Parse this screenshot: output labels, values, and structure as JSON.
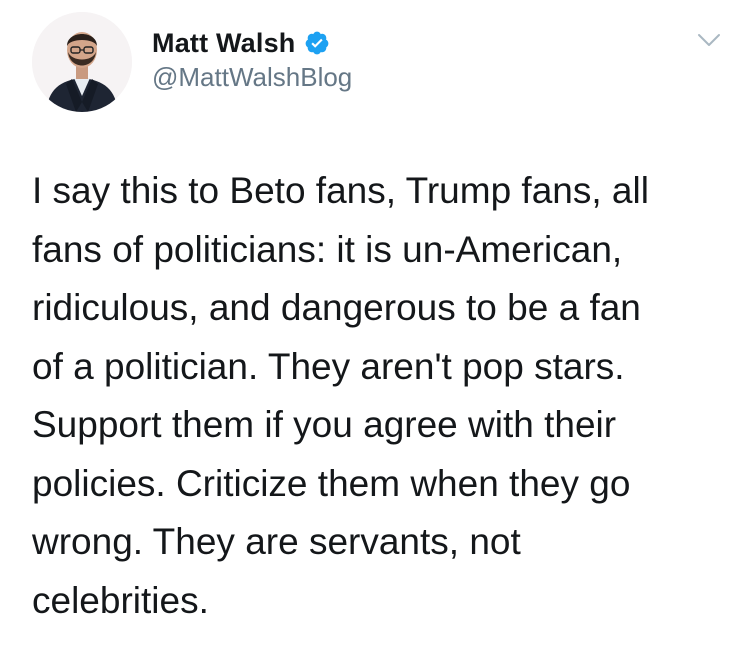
{
  "tweet": {
    "author": {
      "display_name": "Matt Walsh",
      "handle": "@MattWalshBlog",
      "verified": true,
      "avatar_icon": "profile-photo"
    },
    "menu_icon": "chevron-down-icon",
    "accent_color": "#1da1f2",
    "text_lines": [
      "I say this to Beto fans, Trump fans, all",
      "fans of politicians: it is un-American,",
      "ridiculous, and dangerous to be a fan",
      "of a politician. They aren't pop stars.",
      "Support them if you agree with their",
      "policies. Criticize them when they go",
      "wrong. They are servants, not",
      "celebrities."
    ]
  }
}
